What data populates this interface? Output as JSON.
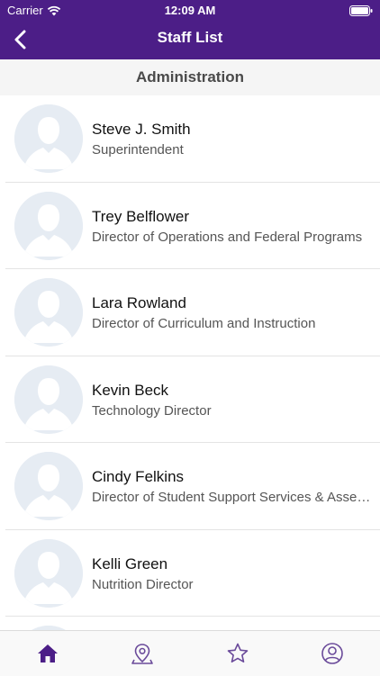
{
  "status_bar": {
    "carrier": "Carrier",
    "time": "12:09 AM"
  },
  "nav": {
    "title": "Staff List"
  },
  "section": {
    "title": "Administration"
  },
  "staff": [
    {
      "name": "Steve J. Smith",
      "title": "Superintendent"
    },
    {
      "name": "Trey Belflower",
      "title": "Director of Operations and Federal Programs"
    },
    {
      "name": "Lara Rowland",
      "title": "Director of Curriculum and Instruction"
    },
    {
      "name": "Kevin Beck",
      "title": "Technology Director"
    },
    {
      "name": "Cindy Felkins",
      "title": "Director of Student Support Services & Assessment"
    },
    {
      "name": "Kelli Green",
      "title": "Nutrition Director"
    }
  ],
  "tabs": [
    {
      "icon": "home-icon",
      "active": true
    },
    {
      "icon": "map-pin-icon",
      "active": false
    },
    {
      "icon": "star-icon",
      "active": false
    },
    {
      "icon": "profile-icon",
      "active": false
    }
  ],
  "colors": {
    "header": "#4c1e87",
    "accent": "#4c1e87",
    "inactive_icon": "#6a4a9a",
    "section_bg": "#f5f5f5"
  }
}
